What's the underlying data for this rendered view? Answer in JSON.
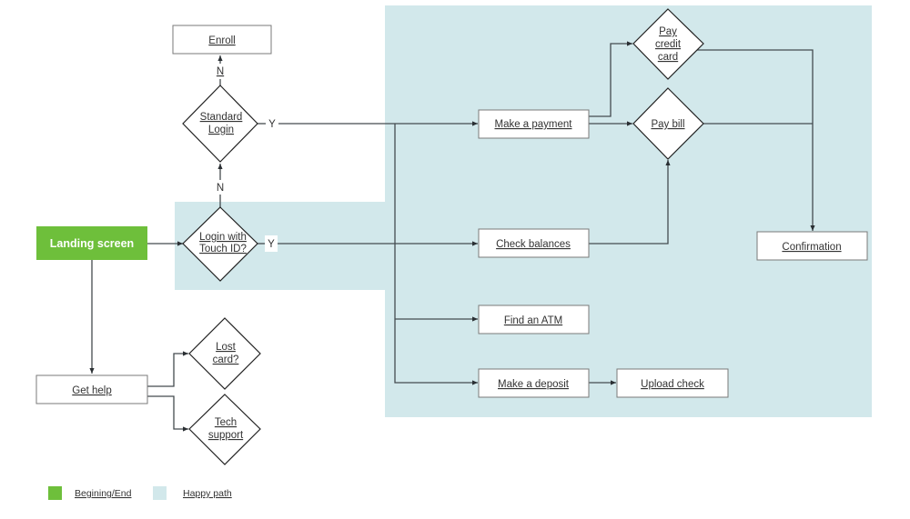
{
  "diagram": {
    "colors": {
      "start_end": "#6ebf3b",
      "happy_path": "#d2e8eb",
      "line": "#444b4f",
      "text": "#333333"
    },
    "nodes": {
      "landing": {
        "label": "Landing screen",
        "type": "start"
      },
      "touch_id": {
        "lines": [
          "Login with",
          "Touch ID?"
        ],
        "type": "decision"
      },
      "standard_login": {
        "lines": [
          "Standard",
          "Login"
        ],
        "type": "decision"
      },
      "enroll": {
        "label": "Enroll",
        "type": "process"
      },
      "make_payment": {
        "label": "Make a payment",
        "type": "process"
      },
      "pay_credit_card": {
        "lines": [
          "Pay",
          "credit",
          "card"
        ],
        "type": "decision"
      },
      "pay_bill": {
        "lines": [
          "Pay bill"
        ],
        "type": "decision"
      },
      "confirmation": {
        "label": "Confirmation",
        "type": "process"
      },
      "check_balances": {
        "label": "Check balances",
        "type": "process"
      },
      "find_atm": {
        "label": "Find an ATM",
        "type": "process"
      },
      "make_deposit": {
        "label": "Make a deposit",
        "type": "process"
      },
      "upload_check": {
        "label": "Upload check",
        "type": "process"
      },
      "get_help": {
        "label": "Get help",
        "type": "process"
      },
      "lost_card": {
        "lines": [
          "Lost",
          "card?"
        ],
        "type": "decision"
      },
      "tech_support": {
        "lines": [
          "Tech",
          "support"
        ],
        "type": "decision"
      }
    },
    "edge_labels": {
      "touch_id_yes": "Y",
      "touch_id_no": "N",
      "standard_yes": "Y",
      "standard_no": "N"
    },
    "edges": [
      {
        "from": "landing",
        "to": "touch_id"
      },
      {
        "from": "landing",
        "to": "get_help"
      },
      {
        "from": "touch_id",
        "to": "standard_login",
        "label": "N"
      },
      {
        "from": "touch_id",
        "to": "check_balances",
        "label": "Y"
      },
      {
        "from": "standard_login",
        "to": "enroll",
        "label": "N"
      },
      {
        "from": "standard_login",
        "to": "make_payment",
        "label": "Y"
      },
      {
        "from": "standard_login",
        "to": "find_atm"
      },
      {
        "from": "standard_login",
        "to": "make_deposit"
      },
      {
        "from": "make_payment",
        "to": "pay_credit_card"
      },
      {
        "from": "make_payment",
        "to": "pay_bill"
      },
      {
        "from": "check_balances",
        "to": "pay_bill"
      },
      {
        "from": "pay_credit_card",
        "to": "confirmation"
      },
      {
        "from": "pay_bill",
        "to": "confirmation"
      },
      {
        "from": "make_deposit",
        "to": "upload_check"
      },
      {
        "from": "get_help",
        "to": "lost_card"
      },
      {
        "from": "get_help",
        "to": "tech_support"
      }
    ],
    "legend": [
      {
        "label": "Begining/End",
        "color": "#6ebf3b"
      },
      {
        "label": "Happy path",
        "color": "#d2e8eb"
      }
    ]
  }
}
